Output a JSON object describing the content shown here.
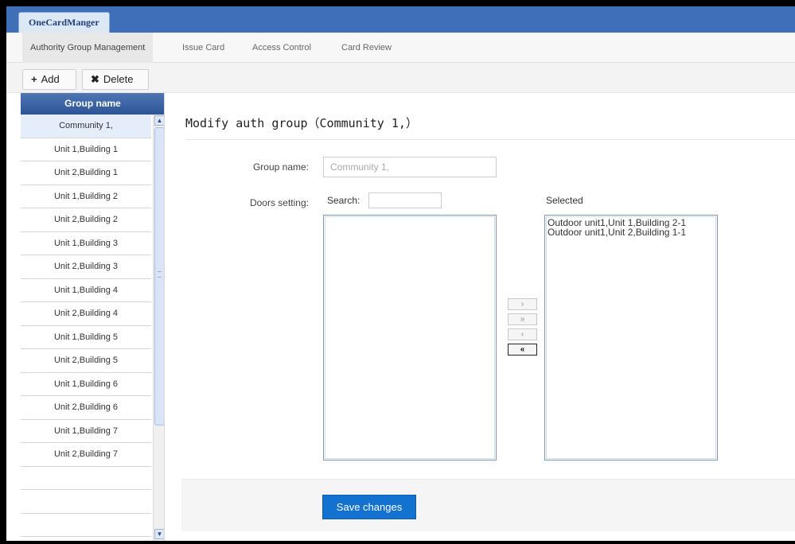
{
  "app": {
    "tab_title": "OneCardManger"
  },
  "nav": {
    "tabs": [
      {
        "label": "Authority Group Management"
      },
      {
        "label": "Issue Card"
      },
      {
        "label": "Access Control"
      },
      {
        "label": "Card Review"
      }
    ]
  },
  "toolbar": {
    "add_label": "Add",
    "delete_label": "Delete",
    "add_icon": "+",
    "delete_icon": "✖"
  },
  "groups": {
    "header": "Group name",
    "items": [
      {
        "label": "Community 1,"
      },
      {
        "label": "Unit 1,Building 1"
      },
      {
        "label": "Unit 2,Building 1"
      },
      {
        "label": "Unit 1,Building 2"
      },
      {
        "label": "Unit 2,Building 2"
      },
      {
        "label": "Unit 1,Building 3"
      },
      {
        "label": "Unit 2,Building 3"
      },
      {
        "label": "Unit 1,Building 4"
      },
      {
        "label": "Unit 2,Building 4"
      },
      {
        "label": "Unit 1,Building 5"
      },
      {
        "label": "Unit 2,Building 5"
      },
      {
        "label": "Unit 1,Building 6"
      },
      {
        "label": "Unit 2,Building 6"
      },
      {
        "label": "Unit 1,Building 7"
      },
      {
        "label": "Unit 2,Building 7"
      }
    ]
  },
  "form": {
    "title": "Modify auth group（Community 1,）",
    "group_name_label": "Group name:",
    "group_name_value": "Community 1,",
    "doors_label": "Doors setting:",
    "search_label": "Search:",
    "search_value": "",
    "selected_label": "Selected",
    "selected_items": [
      {
        "label": "Outdoor unit1,Unit 1,Building 2-1"
      },
      {
        "label": "Outdoor unit1,Unit 2,Building 1-1"
      }
    ],
    "move_buttons": {
      "add_one": "›",
      "add_all": "»",
      "remove_one": "‹",
      "remove_all": "«"
    },
    "save_label": "Save changes"
  },
  "colors": {
    "title_bar": "#3f6fb8",
    "header": "#2c5395",
    "primary_button": "#1371d0",
    "selected_row": "#e4edf9"
  }
}
